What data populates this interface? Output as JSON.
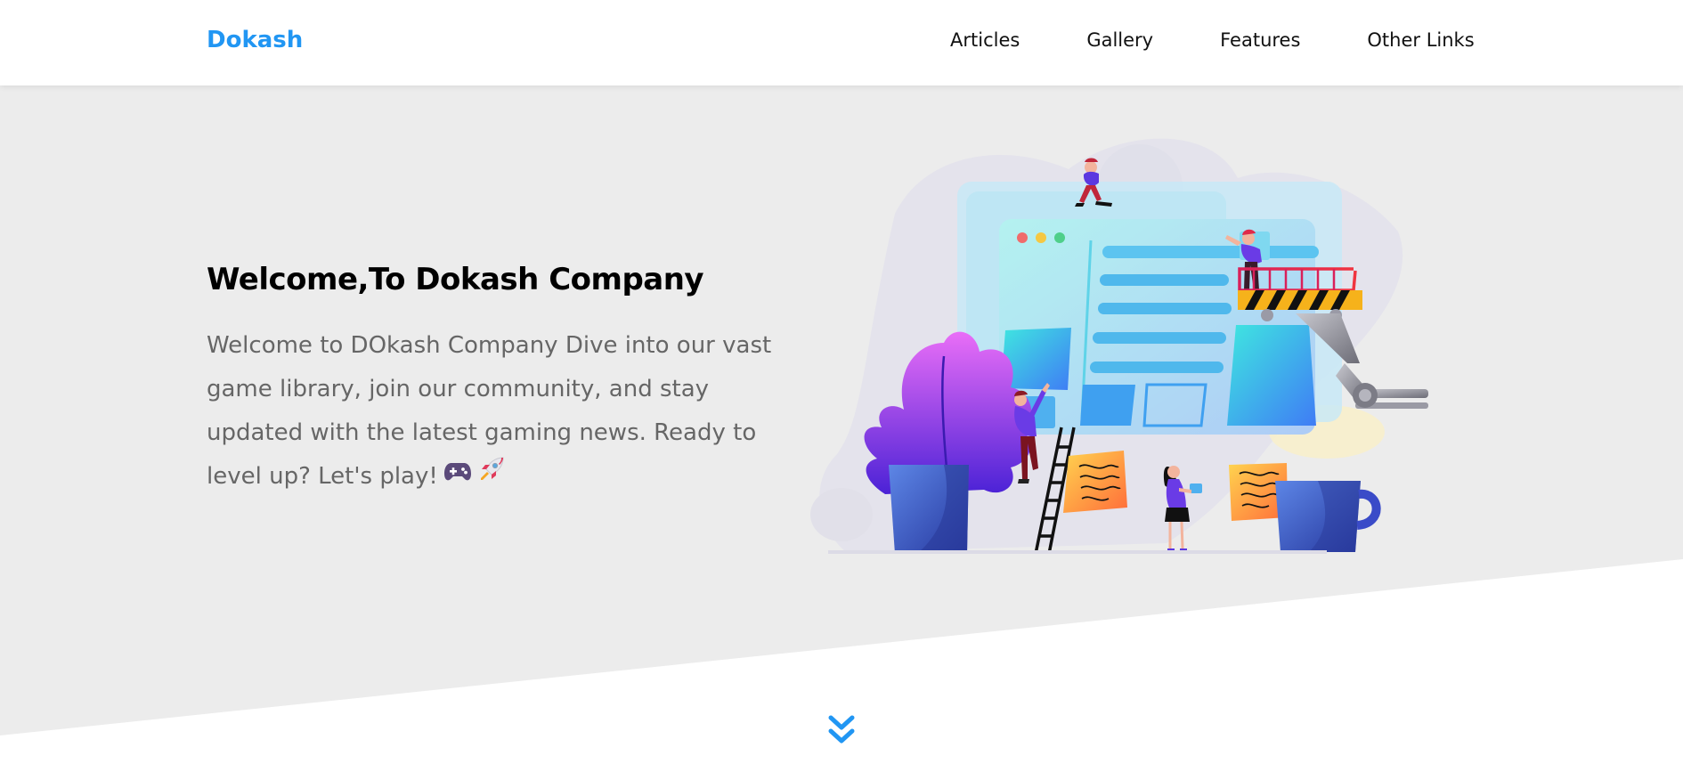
{
  "header": {
    "logo": "Dokash",
    "nav": [
      {
        "label": "Articles"
      },
      {
        "label": "Gallery"
      },
      {
        "label": "Features"
      },
      {
        "label": "Other Links"
      }
    ]
  },
  "hero": {
    "title": "Welcome,To Dokash Company",
    "description": "Welcome to DOkash Company Dive into our vast game library, join our community, and stay updated with the latest gaming news. Ready to level up? Let's play!"
  },
  "icons": {
    "game_controller": "game-controller-icon",
    "rocket": "rocket-icon",
    "scroll_down": "double-chevron-down-icon"
  },
  "colors": {
    "brand": "#2196f3",
    "hero_background": "#ececec"
  }
}
